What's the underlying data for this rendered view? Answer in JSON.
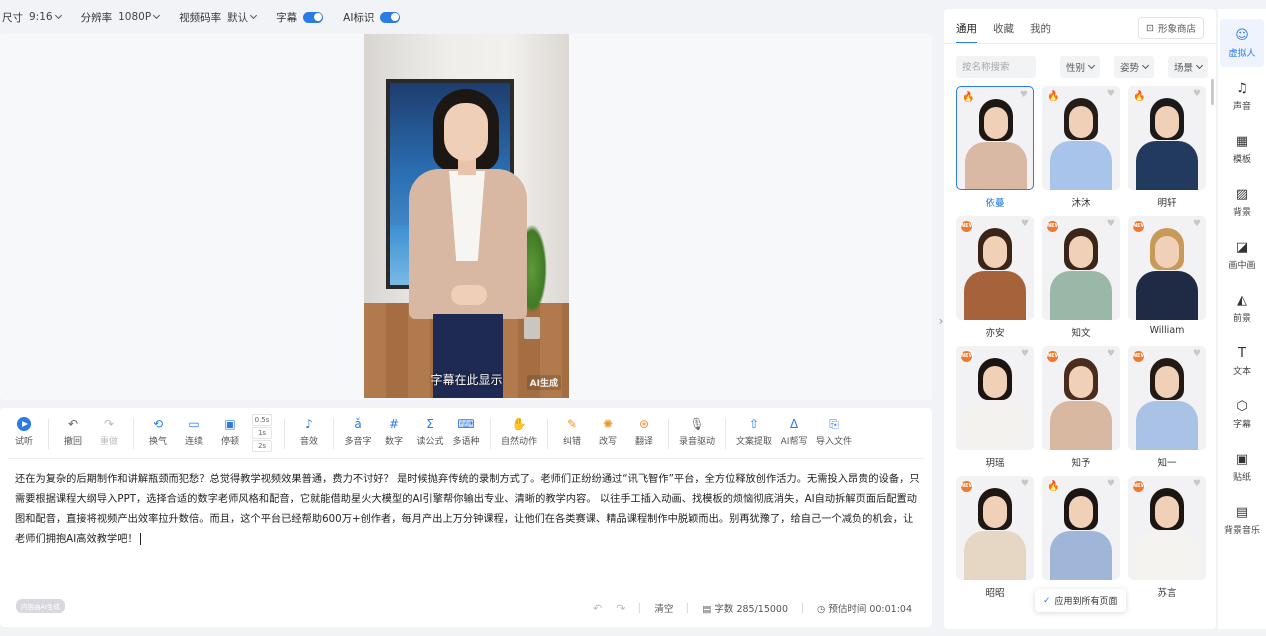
{
  "topbar": {
    "size_label": "尺寸",
    "size_value": "9:16",
    "resolution_label": "分辨率",
    "resolution_value": "1080P",
    "bitrate_label": "视频码率",
    "bitrate_value": "默认",
    "subtitle_label": "字幕",
    "subtitle_on": true,
    "ai_label": "AI标识",
    "ai_on": true
  },
  "preview": {
    "caption": "字幕在此显示",
    "ai_tag": "AI生成"
  },
  "toolbar": {
    "audition": "试听",
    "undo": "撤回",
    "redo": "重做",
    "breath": "换气",
    "continuous": "连续",
    "pause": "停顿",
    "pause_options": [
      "0.5s",
      "1s",
      "2s"
    ],
    "sound_effect": "音效",
    "polyphone": "多音字",
    "number": "数字",
    "formula": "读公式",
    "multilang": "多语种",
    "natural_action": "自然动作",
    "correct": "纠错",
    "rewrite": "改写",
    "translate": "翻译",
    "record_drive": "录音驱动",
    "extract": "文案提取",
    "ai_write": "AI帮写",
    "import_file": "导入文件"
  },
  "script": {
    "text": "还在为复杂的后期制作和讲解瓶颈而犯愁？总觉得教学视频效果普通，费力不讨好？ 是时候抛弃传统的录制方式了。老师们正纷纷通过“讯飞智作”平台，全方位释放创作活力。无需投入昂贵的设备，只需要根据课程大纲导入PPT，选择合适的数字老师风格和配音，它就能借助星火大模型的AI引擎帮你输出专业、清晰的教学内容。 以往手工插入动画、找模板的烦恼彻底消失，AI自动拆解页面后配置动图和配音，直接将视频产出效率拉升数倍。而且，这个平台已经帮助600万+创作者，每月产出上万分钟课程，让他们在各类赛课、精品课程制作中脱颖而出。别再犹豫了，给自己一个减负的机会，让老师们拥抱AI高效教学吧！",
    "ai_badge": "内容由AI生成"
  },
  "footer": {
    "clear": "清空",
    "word_count": "字数 285/15000",
    "est_time": "预估时间 00:01:04"
  },
  "panel": {
    "tabs": [
      "通用",
      "收藏",
      "我的"
    ],
    "shop": "形象商店",
    "search_placeholder": "按名称搜索",
    "filters": [
      "性别",
      "姿势",
      "场景"
    ],
    "avatars": [
      {
        "name": "依蔓",
        "badge": "fire",
        "hair": "#1c1714",
        "body": "#d9b9a3",
        "selected": true
      },
      {
        "name": "沐沐",
        "badge": "fire",
        "hair": "#241c18",
        "body": "#a9c4ea"
      },
      {
        "name": "明轩",
        "badge": "fire",
        "hair": "#1a1a1a",
        "body": "#223a5e"
      },
      {
        "name": "亦安",
        "badge": "new",
        "hair": "#3a2418",
        "body": "#a6623a"
      },
      {
        "name": "知文",
        "badge": "new",
        "hair": "#3b2418",
        "body": "#9ab8a8"
      },
      {
        "name": "William",
        "badge": "new",
        "hair": "#c89a5a",
        "body": "#1f2a44"
      },
      {
        "name": "玥瑶",
        "badge": "new",
        "hair": "#1a1512",
        "body": "#f4f2ef"
      },
      {
        "name": "知予",
        "badge": "new",
        "hair": "#4a2c1c",
        "body": "#d8b8a0"
      },
      {
        "name": "知一",
        "badge": "new",
        "hair": "#231a15",
        "body": "#a9c2e6"
      },
      {
        "name": "昭昭",
        "badge": "new",
        "hair": "#1f1713",
        "body": "#e6d6c4"
      },
      {
        "name": "",
        "badge": "fire",
        "hair": "#1b1613",
        "body": "#9fb6d8"
      },
      {
        "name": "苏言",
        "badge": "new",
        "hair": "#1c1613",
        "body": "#f5f3f0"
      }
    ],
    "apply_tip": "应用到所有页面"
  },
  "sidenav": [
    {
      "label": "虚拟人",
      "icon": "avatar-icon",
      "glyph": "☺",
      "active": true
    },
    {
      "label": "声音",
      "icon": "music-icon",
      "glyph": "♫"
    },
    {
      "label": "模板",
      "icon": "template-icon",
      "glyph": "▦"
    },
    {
      "label": "背景",
      "icon": "background-icon",
      "glyph": "▨"
    },
    {
      "label": "画中画",
      "icon": "pip-icon",
      "glyph": "◪"
    },
    {
      "label": "前景",
      "icon": "foreground-icon",
      "glyph": "◭"
    },
    {
      "label": "文本",
      "icon": "text-icon",
      "glyph": "T"
    },
    {
      "label": "字幕",
      "icon": "subtitle-icon",
      "glyph": "⬡"
    },
    {
      "label": "贴纸",
      "icon": "sticker-icon",
      "glyph": "▣"
    },
    {
      "label": "背景音乐",
      "icon": "bgm-icon",
      "glyph": "▤"
    }
  ],
  "colors": {
    "accent": "#2a7be4",
    "hot": "#ef4b3c",
    "new": "#f0792b"
  }
}
